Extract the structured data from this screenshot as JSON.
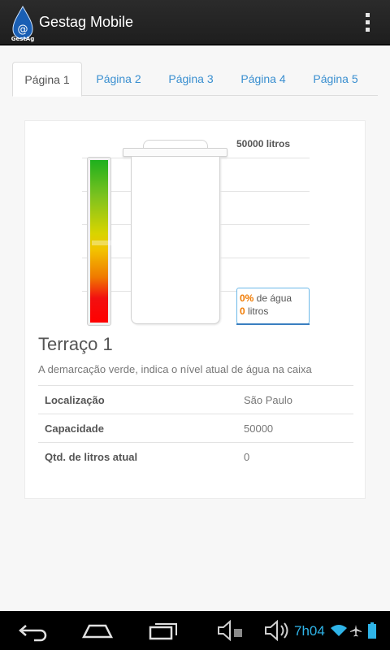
{
  "app": {
    "title": "Gestag Mobile",
    "logo_text": "GestAg"
  },
  "tabs": [
    {
      "label": "Página 1",
      "active": true
    },
    {
      "label": "Página 2",
      "active": false
    },
    {
      "label": "Página 3",
      "active": false
    },
    {
      "label": "Página 4",
      "active": false
    },
    {
      "label": "Página 5",
      "active": false
    }
  ],
  "gauge": {
    "capacity_label": "50000 litros",
    "percent_value": "0%",
    "percent_suffix": " de água",
    "liters_value": "0",
    "liters_suffix": " litros",
    "fill_fraction": 0
  },
  "tank": {
    "name": "Terraço 1",
    "description": "A demarcação verde, indica o nível atual de água na caixa",
    "rows": [
      {
        "label": "Localização",
        "value": "São Paulo"
      },
      {
        "label": "Capacidade",
        "value": "50000"
      },
      {
        "label": "Qtd. de litros atual",
        "value": "0"
      }
    ]
  },
  "status_bar": {
    "time": "7h04"
  },
  "colors": {
    "accent": "#3a8fd0",
    "highlight": "#f07a00",
    "info_border": "#6cb8e8"
  },
  "icons": [
    "overflow-menu-icon",
    "back-icon",
    "home-icon",
    "recent-apps-icon",
    "volume-down-icon",
    "volume-up-icon",
    "wifi-icon",
    "airplane-mode-icon",
    "battery-icon"
  ]
}
